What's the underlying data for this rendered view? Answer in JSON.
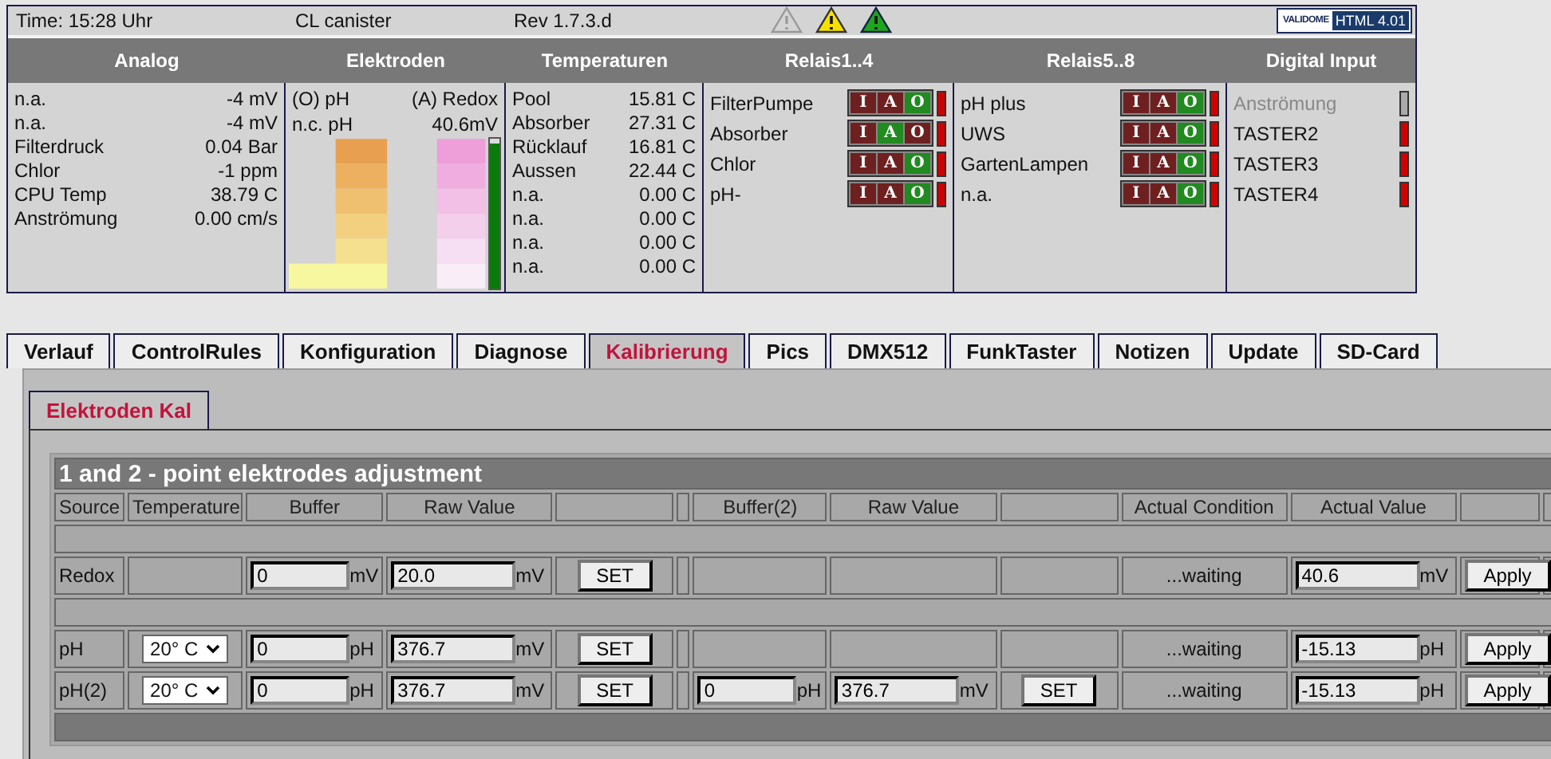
{
  "header": {
    "time": "Time: 15:28 Uhr",
    "status": "CL canister",
    "revision": "Rev 1.7.3.d",
    "badge": {
      "logo": "VALIDOME",
      "label": "HTML 4.01"
    }
  },
  "sections": [
    "Analog",
    "Elektroden",
    "Temperaturen",
    "Relais1..4",
    "Relais5..8",
    "Digital Input"
  ],
  "analog": [
    {
      "name": "n.a.",
      "value": "-4 mV"
    },
    {
      "name": "n.a.",
      "value": "-4 mV"
    },
    {
      "name": "Filterdruck",
      "value": "0.04 Bar"
    },
    {
      "name": "Chlor",
      "value": "-1 ppm"
    },
    {
      "name": "CPU Temp",
      "value": "38.79 C"
    },
    {
      "name": "Anströmung",
      "value": "0.00 cm/s"
    }
  ],
  "electrodes": {
    "ph_label": "(O) pH",
    "redox_label": "(A) Redox",
    "ph_value": "n.c. pH",
    "redox_value": "40.6mV",
    "redox_meter": {
      "level": 0.97
    }
  },
  "temperatures": [
    {
      "name": "Pool",
      "value": "15.81 C"
    },
    {
      "name": "Absorber",
      "value": "27.31 C"
    },
    {
      "name": "Rücklauf",
      "value": "16.81 C"
    },
    {
      "name": "Aussen",
      "value": "22.44 C"
    },
    {
      "name": "n.a.",
      "value": "0.00 C"
    },
    {
      "name": "n.a.",
      "value": "0.00 C"
    },
    {
      "name": "n.a.",
      "value": "0.00 C"
    },
    {
      "name": "n.a.",
      "value": "0.00 C"
    }
  ],
  "relays_1_4": [
    {
      "name": "FilterPumpe",
      "on": false,
      "modes": [
        {
          "label": "I",
          "selected": false
        },
        {
          "label": "A",
          "selected": false
        },
        {
          "label": "O",
          "selected": true
        }
      ]
    },
    {
      "name": "Absorber",
      "on": false,
      "modes": [
        {
          "label": "I",
          "selected": false
        },
        {
          "label": "A",
          "selected": true
        },
        {
          "label": "O",
          "selected": false
        }
      ]
    },
    {
      "name": "Chlor",
      "on": false,
      "modes": [
        {
          "label": "I",
          "selected": false
        },
        {
          "label": "A",
          "selected": false
        },
        {
          "label": "O",
          "selected": true
        }
      ]
    },
    {
      "name": "pH-",
      "on": false,
      "modes": [
        {
          "label": "I",
          "selected": false
        },
        {
          "label": "A",
          "selected": false
        },
        {
          "label": "O",
          "selected": true
        }
      ]
    }
  ],
  "relays_5_8": [
    {
      "name": "pH plus",
      "on": false,
      "modes": [
        {
          "label": "I",
          "selected": false
        },
        {
          "label": "A",
          "selected": false
        },
        {
          "label": "O",
          "selected": true
        }
      ]
    },
    {
      "name": "UWS",
      "on": false,
      "modes": [
        {
          "label": "I",
          "selected": false
        },
        {
          "label": "A",
          "selected": false
        },
        {
          "label": "O",
          "selected": true
        }
      ]
    },
    {
      "name": "GartenLampen",
      "on": false,
      "modes": [
        {
          "label": "I",
          "selected": false
        },
        {
          "label": "A",
          "selected": false
        },
        {
          "label": "O",
          "selected": true
        }
      ]
    },
    {
      "name": "n.a.",
      "on": false,
      "modes": [
        {
          "label": "I",
          "selected": false
        },
        {
          "label": "A",
          "selected": false
        },
        {
          "label": "O",
          "selected": true
        }
      ]
    }
  ],
  "digital_inputs": [
    {
      "name": "Anströmung",
      "disabled": true,
      "on": false
    },
    {
      "name": "TASTER2",
      "disabled": false,
      "on": false
    },
    {
      "name": "TASTER3",
      "disabled": false,
      "on": false
    },
    {
      "name": "TASTER4",
      "disabled": false,
      "on": false
    }
  ],
  "tabs": [
    {
      "label": "Verlauf",
      "selected": false
    },
    {
      "label": "ControlRules",
      "selected": false
    },
    {
      "label": "Konfiguration",
      "selected": false
    },
    {
      "label": "Diagnose",
      "selected": false
    },
    {
      "label": "Kalibrierung",
      "selected": true
    },
    {
      "label": "Pics",
      "selected": false
    },
    {
      "label": "DMX512",
      "selected": false
    },
    {
      "label": "FunkTaster",
      "selected": false
    },
    {
      "label": "Notizen",
      "selected": false
    },
    {
      "label": "Update",
      "selected": false
    },
    {
      "label": "SD-Card",
      "selected": false
    }
  ],
  "subtabs": [
    {
      "label": "Elektroden Kal",
      "selected": true
    }
  ],
  "table": {
    "title": "1 and 2 - point elektrodes adjustment",
    "columns": [
      "Source",
      "Temperature",
      "Buffer",
      "Raw Value",
      "",
      "",
      "Buffer(2)",
      "Raw Value",
      "",
      "Actual Condition",
      "Actual Value",
      "",
      ""
    ],
    "rows": [
      {
        "kind": "spacer"
      },
      {
        "kind": "data",
        "source": "Redox",
        "buffer": {
          "value": "0",
          "unit": "mV"
        },
        "raw": {
          "value": "20.0",
          "unit": "mV"
        },
        "set": "SET",
        "condition": "...waiting",
        "actual": {
          "value": "40.6",
          "unit": "mV"
        },
        "apply": "Apply"
      },
      {
        "kind": "spacer"
      },
      {
        "kind": "data",
        "source": "pH",
        "temperature": "20° C",
        "buffer": {
          "value": "0",
          "unit": "pH"
        },
        "raw": {
          "value": "376.7",
          "unit": "mV"
        },
        "set": "SET",
        "condition": "...waiting",
        "actual": {
          "value": "-15.13",
          "unit": "pH"
        },
        "apply": "Apply"
      },
      {
        "kind": "data",
        "source": "pH(2)",
        "temperature": "20° C",
        "buffer": {
          "value": "0",
          "unit": "pH"
        },
        "raw": {
          "value": "376.7",
          "unit": "mV"
        },
        "set": "SET",
        "buffer2": {
          "value": "0",
          "unit": "pH"
        },
        "raw2": {
          "value": "376.7",
          "unit": "mV"
        },
        "set2": "SET",
        "condition": "...waiting",
        "actual": {
          "value": "-15.13",
          "unit": "pH"
        },
        "apply": "Apply"
      },
      {
        "kind": "footer"
      }
    ]
  }
}
